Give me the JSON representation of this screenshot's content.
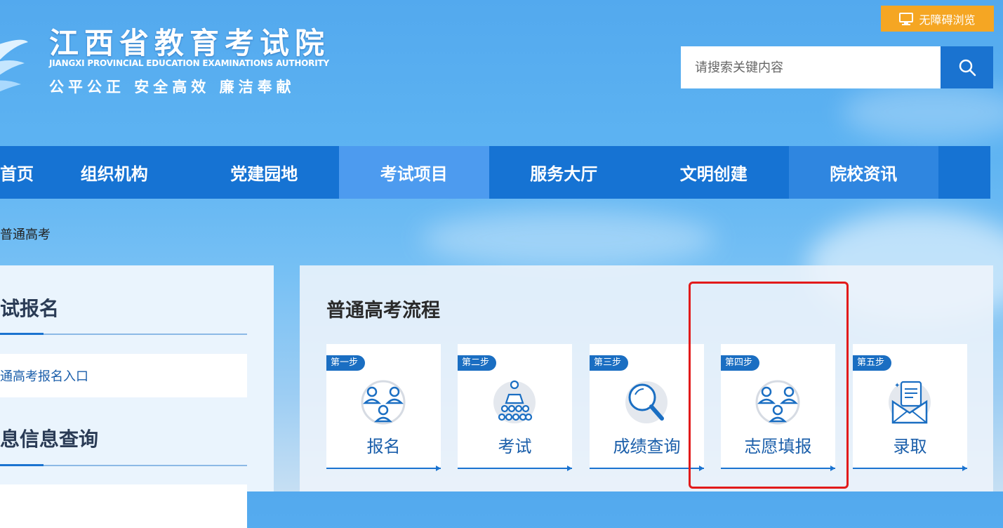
{
  "header": {
    "title_cn": "江西省教育考试院",
    "title_en": "JIANGXI PROVINCIAL EDUCATION EXAMINATIONS AUTHORITY",
    "motto": "公平公正 安全高效 廉洁奉献",
    "accessibility_label": "无障碍浏览",
    "search_placeholder": "请搜索关键内容"
  },
  "nav": {
    "items": [
      {
        "label": "首页"
      },
      {
        "label": "组织机构"
      },
      {
        "label": "党建园地"
      },
      {
        "label": "考试项目"
      },
      {
        "label": "服务大厅"
      },
      {
        "label": "文明创建"
      },
      {
        "label": "院校资讯"
      }
    ],
    "active_index": 3
  },
  "breadcrumb": {
    "current": "普通高考"
  },
  "sidebar": {
    "sections": [
      {
        "title": "试报名",
        "link": "通高考报名入口"
      },
      {
        "title": "息信息查询",
        "link": ""
      }
    ]
  },
  "process": {
    "title": "普通高考流程",
    "steps": [
      {
        "badge": "第一步",
        "label": "报名",
        "icon": "people-icon"
      },
      {
        "badge": "第二步",
        "label": "考试",
        "icon": "exam-hall-icon"
      },
      {
        "badge": "第三步",
        "label": "成绩查询",
        "icon": "magnifier-icon"
      },
      {
        "badge": "第四步",
        "label": "志愿填报",
        "icon": "people-icon"
      },
      {
        "badge": "第五步",
        "label": "录取",
        "icon": "envelope-letter-icon"
      }
    ]
  },
  "colors": {
    "nav_bg": "#1673d3",
    "nav_active": "#4d9bef",
    "accent_orange": "#f5a623",
    "highlight_red": "#e21a1a"
  }
}
